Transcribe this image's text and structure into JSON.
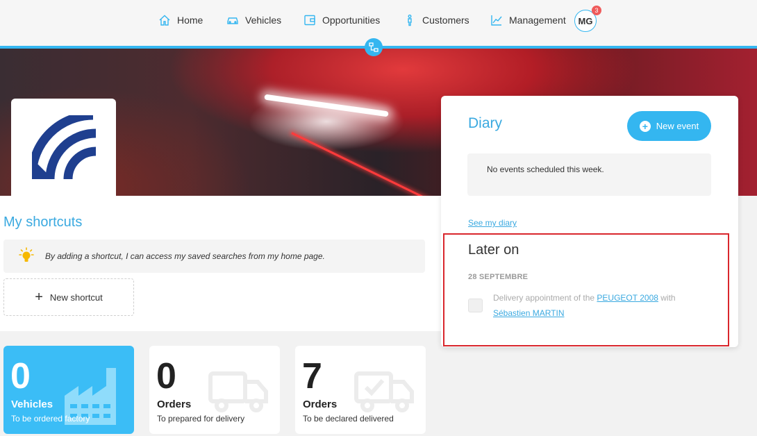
{
  "nav": {
    "items": [
      {
        "label": "Home",
        "icon": "home-icon"
      },
      {
        "label": "Vehicles",
        "icon": "car-icon"
      },
      {
        "label": "Opportunities",
        "icon": "wallet-icon"
      },
      {
        "label": "Customers",
        "icon": "person-icon"
      },
      {
        "label": "Management",
        "icon": "chart-icon"
      }
    ],
    "avatar": "MG",
    "badge": "3"
  },
  "shortcuts": {
    "title": "My shortcuts",
    "tip": "By adding a shortcut, I can access my saved searches from my home page.",
    "new_label": "New shortcut"
  },
  "stats": [
    {
      "value": "0",
      "label": "Vehicles",
      "sub": "To be ordered factory",
      "icon": "factory-icon"
    },
    {
      "value": "0",
      "label": "Orders",
      "sub": "To prepared for delivery",
      "icon": "truck-icon"
    },
    {
      "value": "7",
      "label": "Orders",
      "sub": "To be declared delivered",
      "icon": "truck-check-icon"
    }
  ],
  "diary": {
    "title": "Diary",
    "new_event": "New event",
    "no_events": "No events scheduled this week.",
    "see_diary": "See my diary",
    "later_title": "Later on",
    "date": "28 SEPTEMBRE",
    "event_prefix": "Delivery appointment of the ",
    "event_vehicle": "PEUGEOT 2008",
    "event_mid": " with",
    "event_customer": "Sébastien MARTIN"
  },
  "colors": {
    "accent": "#34b6f0",
    "title_blue": "#3aa9e0",
    "highlight_red": "#d9262c",
    "badge_red": "#ef5b5b",
    "logo_navy": "#1f3f8f"
  }
}
